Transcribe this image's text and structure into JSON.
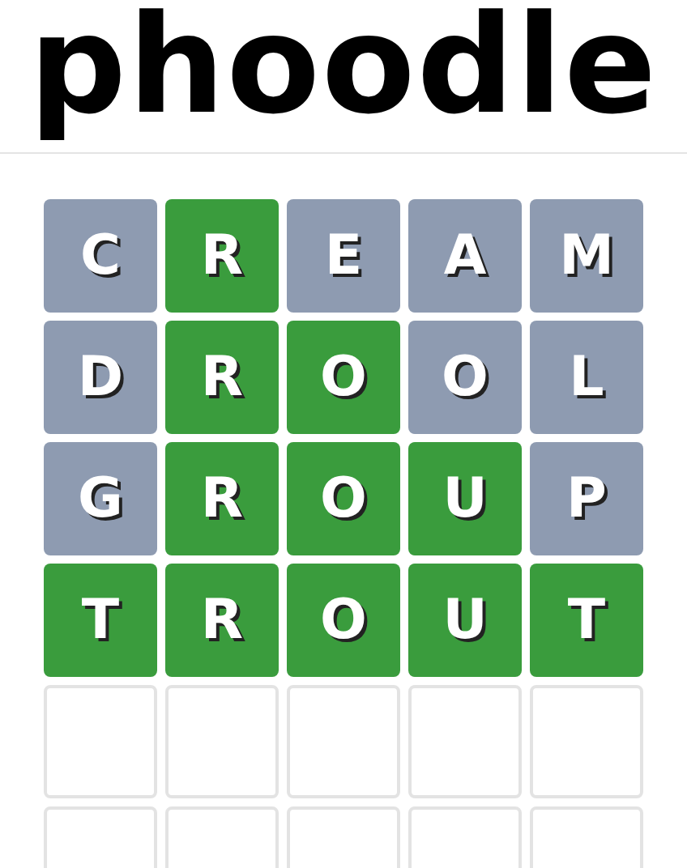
{
  "logo": "phoodle",
  "board": [
    {
      "tiles": [
        {
          "kind": "letter",
          "letter": "C",
          "correct": false
        },
        {
          "kind": "letter",
          "letter": "R",
          "correct": true
        },
        {
          "kind": "letter",
          "letter": "E",
          "correct": false
        },
        {
          "kind": "letter",
          "letter": "A",
          "correct": false
        },
        {
          "kind": "letter",
          "letter": "M",
          "correct": false
        }
      ]
    },
    {
      "tiles": [
        {
          "kind": "letter",
          "letter": "D",
          "correct": false
        },
        {
          "kind": "letter",
          "letter": "R",
          "correct": true
        },
        {
          "kind": "letter",
          "letter": "O",
          "correct": true
        },
        {
          "kind": "letter",
          "letter": "O",
          "correct": false
        },
        {
          "kind": "letter",
          "letter": "L",
          "correct": false
        }
      ]
    },
    {
      "tiles": [
        {
          "kind": "letter",
          "letter": "G",
          "correct": false
        },
        {
          "kind": "letter",
          "letter": "R",
          "correct": true
        },
        {
          "kind": "letter",
          "letter": "O",
          "correct": true
        },
        {
          "kind": "letter",
          "letter": "U",
          "correct": true
        },
        {
          "kind": "letter",
          "letter": "P",
          "correct": false
        }
      ]
    },
    {
      "tiles": [
        {
          "kind": "letter",
          "letter": "T",
          "correct": true
        },
        {
          "kind": "letter",
          "letter": "R",
          "correct": true
        },
        {
          "kind": "letter",
          "letter": "O",
          "correct": true
        },
        {
          "kind": "letter",
          "letter": "U",
          "correct": true
        },
        {
          "kind": "letter",
          "letter": "T",
          "correct": true
        }
      ]
    },
    {
      "tiles": [
        {
          "kind": "empty"
        },
        {
          "kind": "empty"
        },
        {
          "kind": "empty"
        },
        {
          "kind": "empty"
        },
        {
          "kind": "empty"
        }
      ]
    },
    {
      "tiles": [
        {
          "kind": "empty"
        },
        {
          "kind": "empty"
        },
        {
          "kind": "empty"
        },
        {
          "kind": "empty"
        },
        {
          "kind": "empty"
        }
      ]
    }
  ]
}
